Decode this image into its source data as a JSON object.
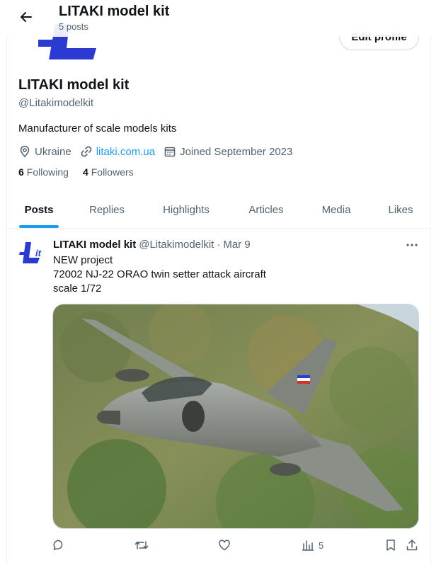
{
  "header": {
    "title": "LITAKI model kit",
    "post_count": "5 posts"
  },
  "profile": {
    "edit_label": "Edit profile",
    "display_name": "LITAKI model kit",
    "handle": "@Litakimodelkit",
    "bio": "Manufacturer of scale models kits",
    "location": "Ukraine",
    "website": "litaki.com.ua",
    "joined": "Joined September 2023",
    "following_count": "6",
    "following_label": "Following",
    "followers_count": "4",
    "followers_label": "Followers"
  },
  "tabs": [
    {
      "label": "Posts",
      "active": true
    },
    {
      "label": "Replies"
    },
    {
      "label": "Highlights"
    },
    {
      "label": "Articles"
    },
    {
      "label": "Media"
    },
    {
      "label": "Likes"
    }
  ],
  "post": {
    "author_name": "LITAKI model kit",
    "author_handle": "@Litakimodelkit",
    "separator": "·",
    "date": "Mar 9",
    "lines": [
      "NEW project",
      "72002 NJ-22 ORAO twin setter attack aircraft",
      "scale 1/72"
    ],
    "views": "5"
  },
  "colors": {
    "accent": "#1d9bf0",
    "brand_blue": "#2b3bd1",
    "text": "#0f1419",
    "muted": "#536471"
  }
}
